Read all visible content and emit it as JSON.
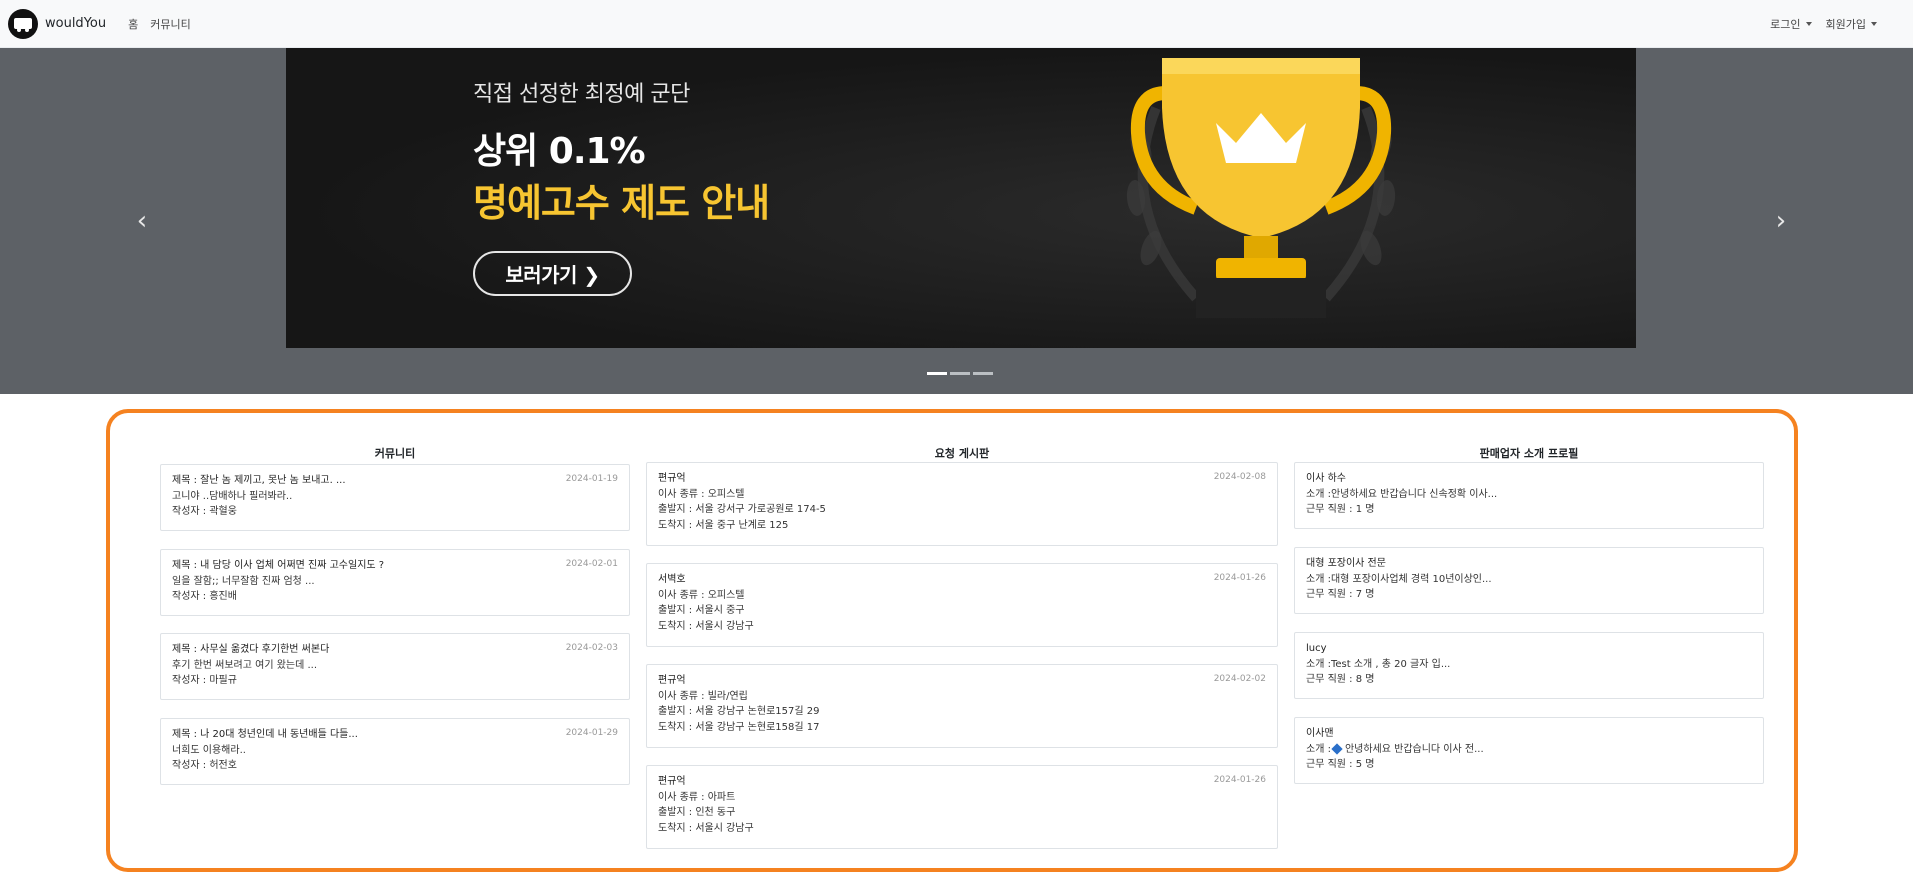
{
  "nav": {
    "brand": "wouldYou",
    "links": [
      "홈",
      "커뮤니티"
    ],
    "right": [
      "로그인",
      "회원가입"
    ]
  },
  "banner": {
    "subtitle": "직접 선정한 최정예 군단",
    "title1": "상위 0.1%",
    "title2": "명예고수 제도 안내",
    "button": "보러가기 ❯",
    "prev": "‹",
    "next": "›"
  },
  "community": {
    "title": "커뮤니티",
    "posts": [
      {
        "title": "제목 : 잘난 놈 제끼고, 못난 놈 보내고. ...",
        "date": "2024-01-19",
        "body": "고니야 ..담배하나 필러봐라..",
        "author": "작성자 : 곽혈웅"
      },
      {
        "title": "제목 : 내 담당 이사 업체 어쩌면 진짜 고수일지도 ?",
        "date": "2024-02-01",
        "body": "일을 잘함;; 너무잘함 진짜 엄청 ...",
        "author": "작성자 : 홍진배"
      },
      {
        "title": "제목 : 사무실 옮겼다 후기한번 써본다",
        "date": "2024-02-03",
        "body": "후기 한번 써보려고 여기 왔는데 ...",
        "author": "작성자 : 마필규"
      },
      {
        "title": "제목 : 나 20대 청년인데 내 동년배들 다들...",
        "date": "2024-01-29",
        "body": "너희도 이용해라..",
        "author": "작성자 : 허전호"
      }
    ]
  },
  "requests": {
    "title": "요청 게시판",
    "posts": [
      {
        "name": "편규억",
        "date": "2024-02-08",
        "type": "이사 종류 : 오피스텔",
        "from": "출발지 : 서울 강서구 가로공원로 174-5",
        "to": "도착지 : 서울 중구 난계로 125"
      },
      {
        "name": "서벽호",
        "date": "2024-01-26",
        "type": "이사 종류 : 오피스텔",
        "from": "출발지 : 서울시 중구",
        "to": "도착지 : 서울시 강남구"
      },
      {
        "name": "편규억",
        "date": "2024-02-02",
        "type": "이사 종류 : 빌라/연립",
        "from": "출발지 : 서울 강남구 논현로157길 29",
        "to": "도착지 : 서울 강남구 논현로158길 17"
      },
      {
        "name": "편규억",
        "date": "2024-01-26",
        "type": "이사 종류 : 아파트",
        "from": "출발지 : 인천 동구",
        "to": "도착지 : 서울시 강남구"
      }
    ]
  },
  "sellers": {
    "title": "판매업자 소개 프로필",
    "profiles": [
      {
        "name": "이사 하수",
        "intro": "소개 :안녕하세요 반갑습니다 신속정확 이사...",
        "staff": "근무 직원 : 1 명"
      },
      {
        "name": "대형 포장이사 전문",
        "intro": "소개 :대형 포장이사업체 경력 10년이상인...",
        "staff": "근무 직원 : 7 명"
      },
      {
        "name": "lucy",
        "intro": "소개 :Test 소개 , 총 20 글자 입...",
        "staff": "근무 직원 : 8 명"
      },
      {
        "name": "이사맨",
        "intro_prefix": "소개 :",
        "intro": "안녕하세요 반갑습니다 이사 전...",
        "staff": "근무 직원 : 5 명"
      }
    ]
  },
  "colors": {
    "accent_border": "#f58220",
    "banner_gold": "#f7c531",
    "carousel_bg": "#5d6166"
  },
  "icons": {
    "brand": "truck-logo-icon",
    "prev": "chevron-left-icon",
    "next": "chevron-right-icon",
    "seller4": "blue-diamond-icon"
  }
}
